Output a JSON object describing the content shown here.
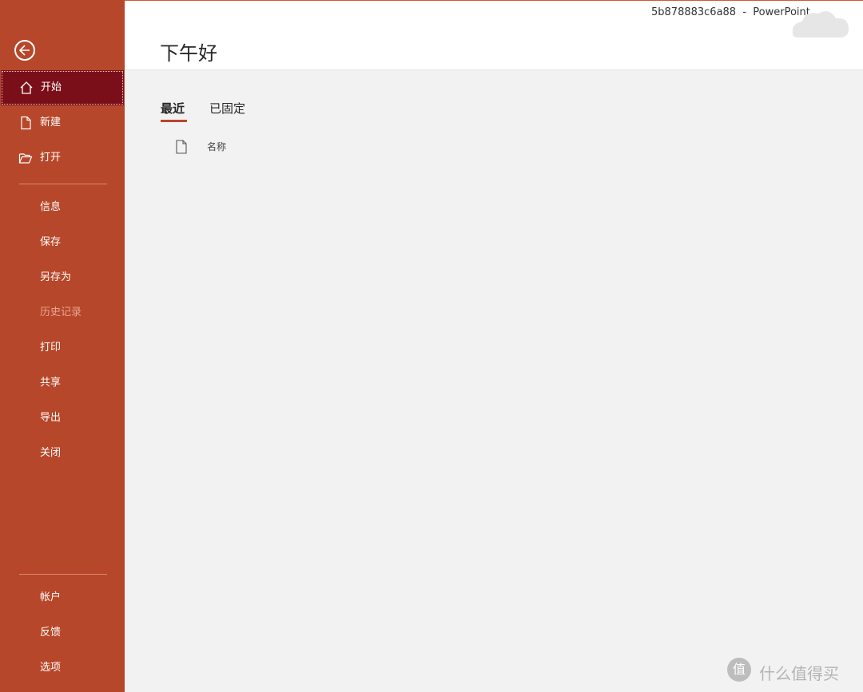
{
  "window": {
    "title": "5b878883c6a88  -  PowerPoint"
  },
  "header": {
    "greeting": "下午好"
  },
  "sidebar": {
    "back_icon": "back-arrow-icon",
    "top_items": [
      {
        "label": "开始",
        "icon": "home-icon",
        "active": true
      },
      {
        "label": "新建",
        "icon": "new-file-icon"
      },
      {
        "label": "打开",
        "icon": "folder-open-icon"
      }
    ],
    "middle_items": [
      {
        "label": "信息"
      },
      {
        "label": "保存"
      },
      {
        "label": "另存为"
      },
      {
        "label": "历史记录",
        "disabled": true
      },
      {
        "label": "打印"
      },
      {
        "label": "共享"
      },
      {
        "label": "导出"
      },
      {
        "label": "关闭"
      }
    ],
    "bottom_items": [
      {
        "label": "帐户"
      },
      {
        "label": "反馈"
      },
      {
        "label": "选项"
      }
    ]
  },
  "main": {
    "tabs": [
      {
        "label": "最近",
        "selected": true
      },
      {
        "label": "已固定",
        "selected": false
      }
    ],
    "column_header": {
      "name": "名称",
      "icon": "document-icon"
    }
  },
  "watermark": {
    "text": "什么值得买",
    "logo": "值"
  },
  "colors": {
    "accent": "#b7472a",
    "active": "#7b0f19"
  }
}
